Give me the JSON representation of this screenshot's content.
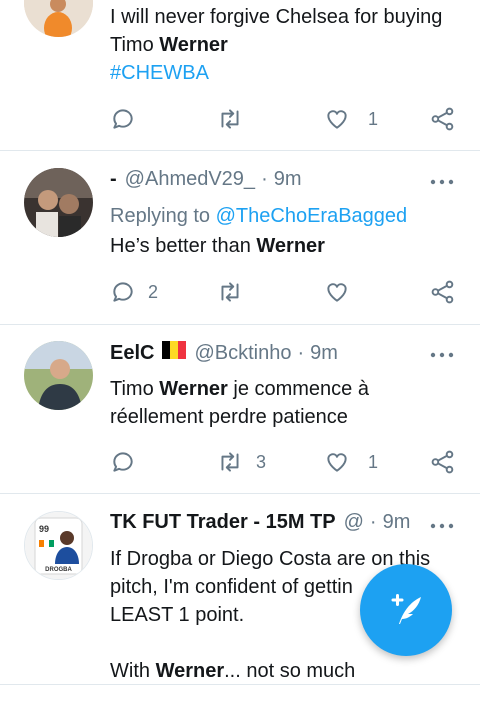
{
  "tweets": [
    {
      "text_parts": [
        "I will never forgive Chelsea for buying",
        "Timo ",
        "Werner"
      ],
      "hashtag": "#CHEWBA",
      "counts": {
        "reply": "",
        "retweet": "",
        "like": "1"
      }
    },
    {
      "name": "-",
      "handle": "@AhmedV29_",
      "sep": "·",
      "time": "9m",
      "replying_prefix": "Replying to ",
      "replying_handle": "@TheChoEraBagged",
      "text_parts": [
        "He’s better than ",
        "Werner"
      ],
      "counts": {
        "reply": "2",
        "retweet": "",
        "like": ""
      }
    },
    {
      "name": "EelC",
      "handle": "@Bcktinho",
      "sep": "·",
      "time": "9m",
      "flag_colors": [
        "#000000",
        "#FDDA24",
        "#EF3340"
      ],
      "text_parts": [
        "Timo ",
        "Werner",
        " je commence à",
        "réellement perdre patience"
      ],
      "counts": {
        "reply": "",
        "retweet": "3",
        "like": "1"
      }
    },
    {
      "name": "TK FUT Trader - 15M TP",
      "handle": "@",
      "sep": "·",
      "time": "9m",
      "avatar_label": "DROGBA",
      "avatar_rating": "99",
      "text_lines": [
        "If Drogba or Diego Costa are on this",
        "pitch, I'm confident of gettin",
        "LEAST 1 point."
      ],
      "text_last": [
        "With ",
        "Werner",
        "... not so much"
      ]
    }
  ],
  "fab": {
    "icon": "compose-tweet-icon"
  },
  "colors": {
    "accent": "#1da1f2",
    "muted": "#657786",
    "divider": "#e1e8ed"
  }
}
